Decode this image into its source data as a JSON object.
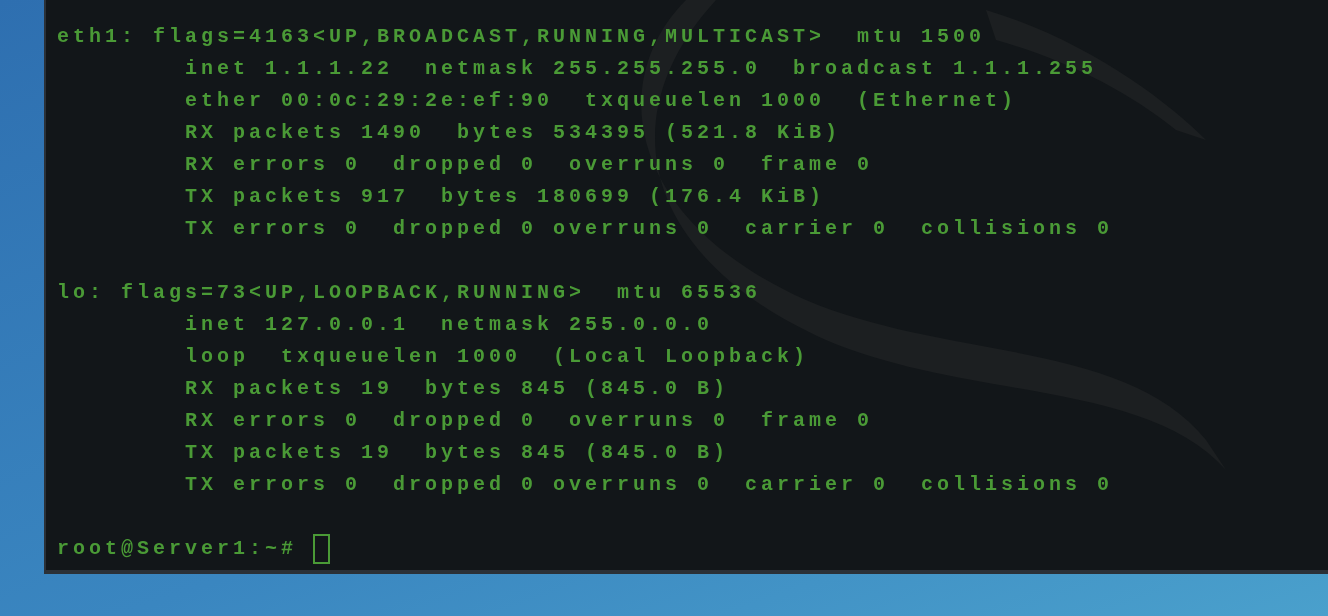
{
  "terminal": {
    "interfaces": [
      {
        "header": "eth1: flags=4163<UP,BROADCAST,RUNNING,MULTICAST>  mtu 1500",
        "details": [
          "inet 1.1.1.22  netmask 255.255.255.0  broadcast 1.1.1.255",
          "ether 00:0c:29:2e:ef:90  txqueuelen 1000  (Ethernet)",
          "RX packets 1490  bytes 534395 (521.8 KiB)",
          "RX errors 0  dropped 0  overruns 0  frame 0",
          "TX packets 917  bytes 180699 (176.4 KiB)",
          "TX errors 0  dropped 0 overruns 0  carrier 0  collisions 0"
        ]
      },
      {
        "header": "lo: flags=73<UP,LOOPBACK,RUNNING>  mtu 65536",
        "details": [
          "inet 127.0.0.1  netmask 255.0.0.0",
          "loop  txqueuelen 1000  (Local Loopback)",
          "RX packets 19  bytes 845 (845.0 B)",
          "RX errors 0  dropped 0  overruns 0  frame 0",
          "TX packets 19  bytes 845 (845.0 B)",
          "TX errors 0  dropped 0 overruns 0  carrier 0  collisions 0"
        ]
      }
    ],
    "prompt": "root@Server1:~#"
  }
}
